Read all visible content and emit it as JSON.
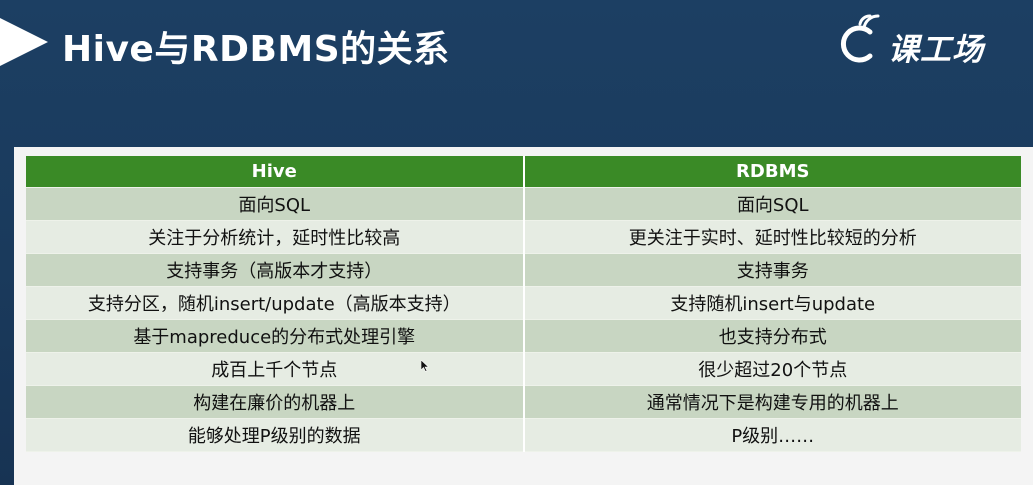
{
  "slide": {
    "title": "Hive与RDBMS的关系"
  },
  "logo": {
    "text": "课工场"
  },
  "table": {
    "headers": [
      "Hive",
      "RDBMS"
    ],
    "rows": [
      [
        "面向SQL",
        "面向SQL"
      ],
      [
        "关注于分析统计，延时性比较高",
        "更关注于实时、延时性比较短的分析"
      ],
      [
        "支持事务（高版本才支持）",
        "支持事务"
      ],
      [
        "支持分区，随机insert/update（高版本支持）",
        "支持随机insert与update"
      ],
      [
        "基于mapreduce的分布式处理引擎",
        "也支持分布式"
      ],
      [
        "成百上千个节点",
        "很少超过20个节点"
      ],
      [
        "构建在廉价的机器上",
        "通常情况下是构建专用的机器上"
      ],
      [
        "能够处理P级别的数据",
        "P级别……"
      ]
    ]
  },
  "colors": {
    "background": "#1a3a5c",
    "header_green": "#3a8a26",
    "row_odd": "#c8d6c2",
    "row_even": "#e6ece3"
  },
  "icons": {
    "title_marker": "play-icon",
    "logo_mark": "signal-c-icon",
    "pointer": "mouse-cursor-icon"
  }
}
